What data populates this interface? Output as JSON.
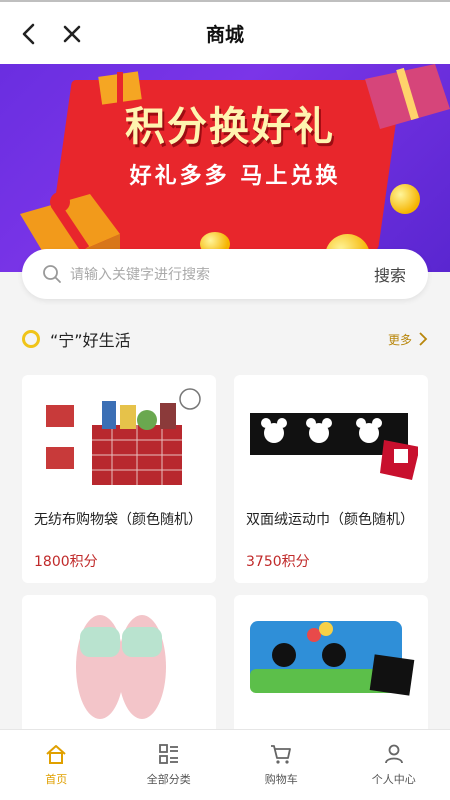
{
  "nav": {
    "title": "商城"
  },
  "banner": {
    "headline": "积分换好礼",
    "subline": "好礼多多  马上兑换"
  },
  "search": {
    "placeholder": "请输入关键字进行搜索",
    "button": "搜索"
  },
  "section": {
    "title": "“宁”好生活",
    "more": "更多"
  },
  "products": [
    {
      "name": "无纺布购物袋（颜色随机）",
      "price": "1800积分"
    },
    {
      "name": "双面绒运动巾（颜色随机）",
      "price": "3750积分"
    },
    {
      "name": "",
      "price": ""
    },
    {
      "name": "",
      "price": ""
    }
  ],
  "tabs": [
    {
      "label": "首页",
      "icon": "home-icon",
      "active": true
    },
    {
      "label": "全部分类",
      "icon": "category-icon",
      "active": false
    },
    {
      "label": "购物车",
      "icon": "cart-icon",
      "active": false
    },
    {
      "label": "个人中心",
      "icon": "user-icon",
      "active": false
    }
  ],
  "colors": {
    "accent": "#e0a000",
    "price": "#c02a2a",
    "banner_red": "#e8262c",
    "banner_purple": "#6a2ee0"
  }
}
